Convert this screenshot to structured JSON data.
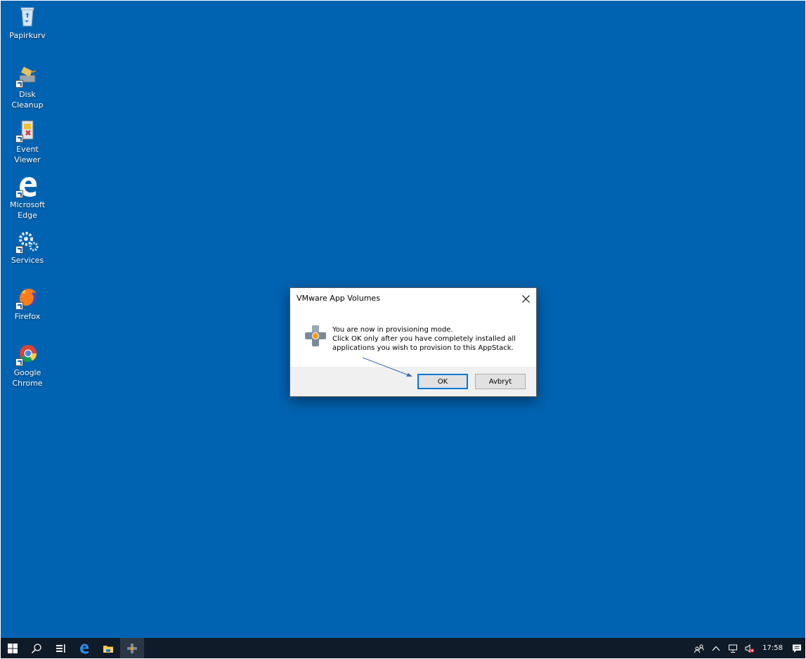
{
  "desktop": {
    "icons": [
      {
        "label": "Papirkurv",
        "icon": "recycle-bin-icon"
      },
      {
        "label": "Disk Cleanup",
        "icon": "disk-cleanup-icon"
      },
      {
        "label": "Event Viewer",
        "icon": "event-viewer-icon"
      },
      {
        "label": "Microsoft Edge",
        "icon": "edge-icon"
      },
      {
        "label": "Services",
        "icon": "services-gears-icon"
      },
      {
        "label": "Firefox",
        "icon": "firefox-icon"
      },
      {
        "label": "Google Chrome",
        "icon": "chrome-icon"
      }
    ]
  },
  "dialog": {
    "title": "VMware App Volumes",
    "message_lines": [
      "You are now in provisioning mode.",
      "Click OK only after you have completely installed all",
      "applications you wish to provision to this AppStack."
    ],
    "ok_label": "OK",
    "cancel_label": "Avbryt"
  },
  "taskbar": {
    "buttons": [
      "start-icon",
      "search-icon",
      "task-view-icon",
      "edge-icon",
      "file-explorer-icon",
      "app-volumes-icon"
    ],
    "clock": "17:58"
  },
  "colors": {
    "desktop_bg": "#0063b1",
    "taskbar_bg": "#101b29",
    "dialog_accent": "#0078d7",
    "annotation_arrow": "#3b6bb5"
  }
}
